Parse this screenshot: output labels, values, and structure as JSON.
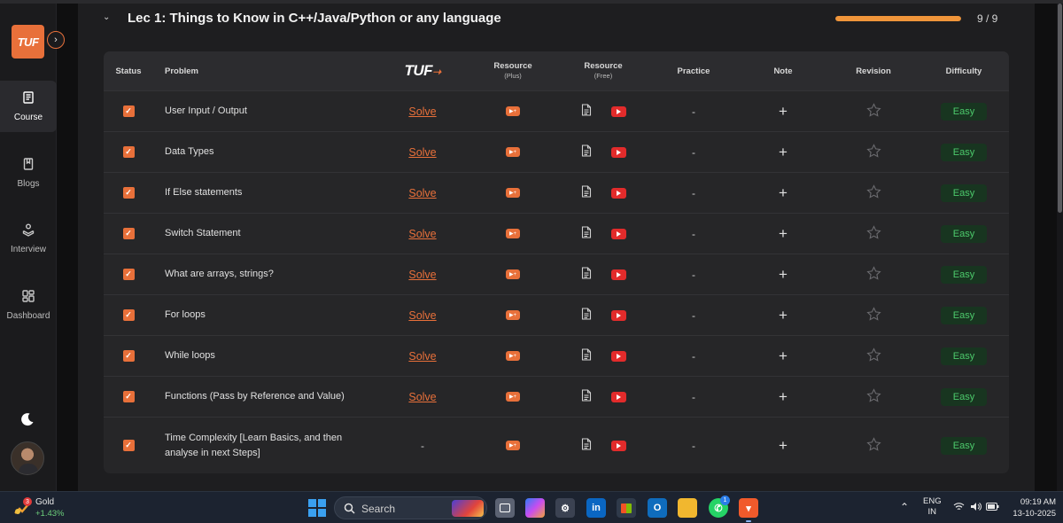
{
  "sidebar": {
    "logo": "TUF",
    "expand_icon": "chevron-right-icon",
    "items": [
      {
        "label": "Course",
        "icon": "book-icon",
        "active": true
      },
      {
        "label": "Blogs",
        "icon": "bookmark-icon",
        "active": false
      },
      {
        "label": "Interview",
        "icon": "interview-icon",
        "active": false
      },
      {
        "label": "Dashboard",
        "icon": "dashboard-icon",
        "active": false
      }
    ],
    "theme_icon": "moon-icon"
  },
  "lecture": {
    "title": "Lec 1: Things to Know in C++/Java/Python or any language",
    "progress_text": "9 / 9",
    "progress_fraction": 1.0,
    "accent_color": "#e8703a"
  },
  "table": {
    "headers": {
      "status": "Status",
      "problem": "Problem",
      "tuf": "TUF",
      "resource_plus": "Resource",
      "resource_plus_sub": "(Plus)",
      "resource_free": "Resource",
      "resource_free_sub": "(Free)",
      "practice": "Practice",
      "note": "Note",
      "revision": "Revision",
      "difficulty": "Difficulty"
    },
    "rows": [
      {
        "problem": "User Input / Output",
        "tuf": "Solve",
        "practice": "-",
        "note": "+",
        "difficulty": "Easy"
      },
      {
        "problem": "Data Types",
        "tuf": "Solve",
        "practice": "-",
        "note": "+",
        "difficulty": "Easy"
      },
      {
        "problem": "If Else statements",
        "tuf": "Solve",
        "practice": "-",
        "note": "+",
        "difficulty": "Easy"
      },
      {
        "problem": "Switch Statement",
        "tuf": "Solve",
        "practice": "-",
        "note": "+",
        "difficulty": "Easy"
      },
      {
        "problem": "What are arrays, strings?",
        "tuf": "Solve",
        "practice": "-",
        "note": "+",
        "difficulty": "Easy"
      },
      {
        "problem": "For loops",
        "tuf": "Solve",
        "practice": "-",
        "note": "+",
        "difficulty": "Easy"
      },
      {
        "problem": "While loops",
        "tuf": "Solve",
        "practice": "-",
        "note": "+",
        "difficulty": "Easy"
      },
      {
        "problem": "Functions (Pass by Reference and Value)",
        "tuf": "Solve",
        "practice": "-",
        "note": "+",
        "difficulty": "Easy"
      },
      {
        "problem_line1": "Time Complexity [Learn Basics, and then",
        "problem_line2": "analyse in next Steps]",
        "tuf": "-",
        "practice": "-",
        "note": "+",
        "difficulty": "Easy"
      }
    ]
  },
  "taskbar": {
    "weather_name": "Gold",
    "weather_value": "+1.43%",
    "weather_badge": "3",
    "search_placeholder": "Search",
    "whatsapp_badge": "1",
    "language": "ENG",
    "region": "IN",
    "time": "09:19 AM",
    "date": "13-10-2025"
  }
}
